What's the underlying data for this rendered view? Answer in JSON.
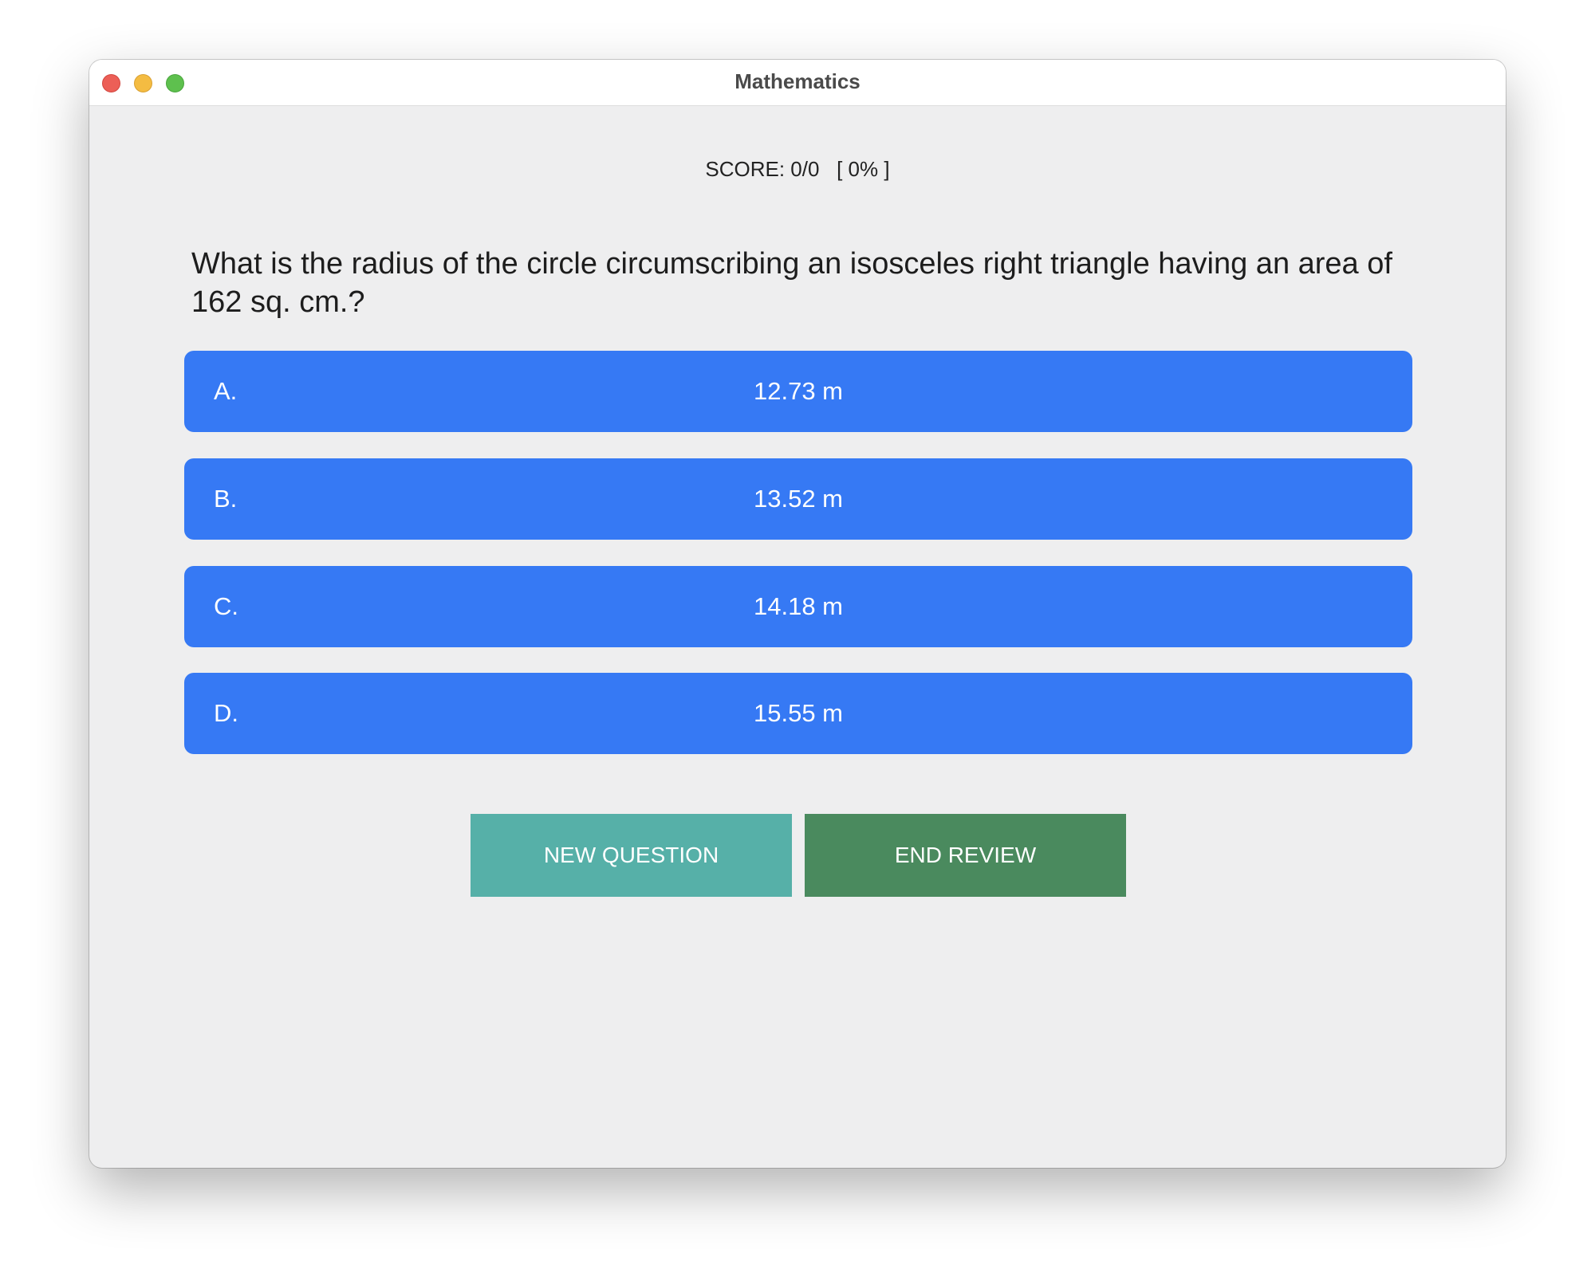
{
  "window": {
    "title": "Mathematics",
    "controls": [
      "close-icon",
      "minimize-icon",
      "zoom-icon"
    ]
  },
  "score": {
    "text": "SCORE: 0/0   [ 0% ]"
  },
  "question": {
    "text": "What is the radius of the circle circumscribing an isosceles right triangle having an area of 162 sq. cm.?"
  },
  "choices": [
    {
      "letter": "A.",
      "answer": "12.73 m"
    },
    {
      "letter": "B.",
      "answer": "13.52 m"
    },
    {
      "letter": "C.",
      "answer": "14.18 m"
    },
    {
      "letter": "D.",
      "answer": "15.55 m"
    }
  ],
  "actions": {
    "new_question": "NEW QUESTION",
    "end_review": "END REVIEW"
  },
  "colors": {
    "choice": "#3679f4",
    "new_question": "#56b0a8",
    "end_review": "#4a8a5e",
    "background": "#eeeeef"
  }
}
